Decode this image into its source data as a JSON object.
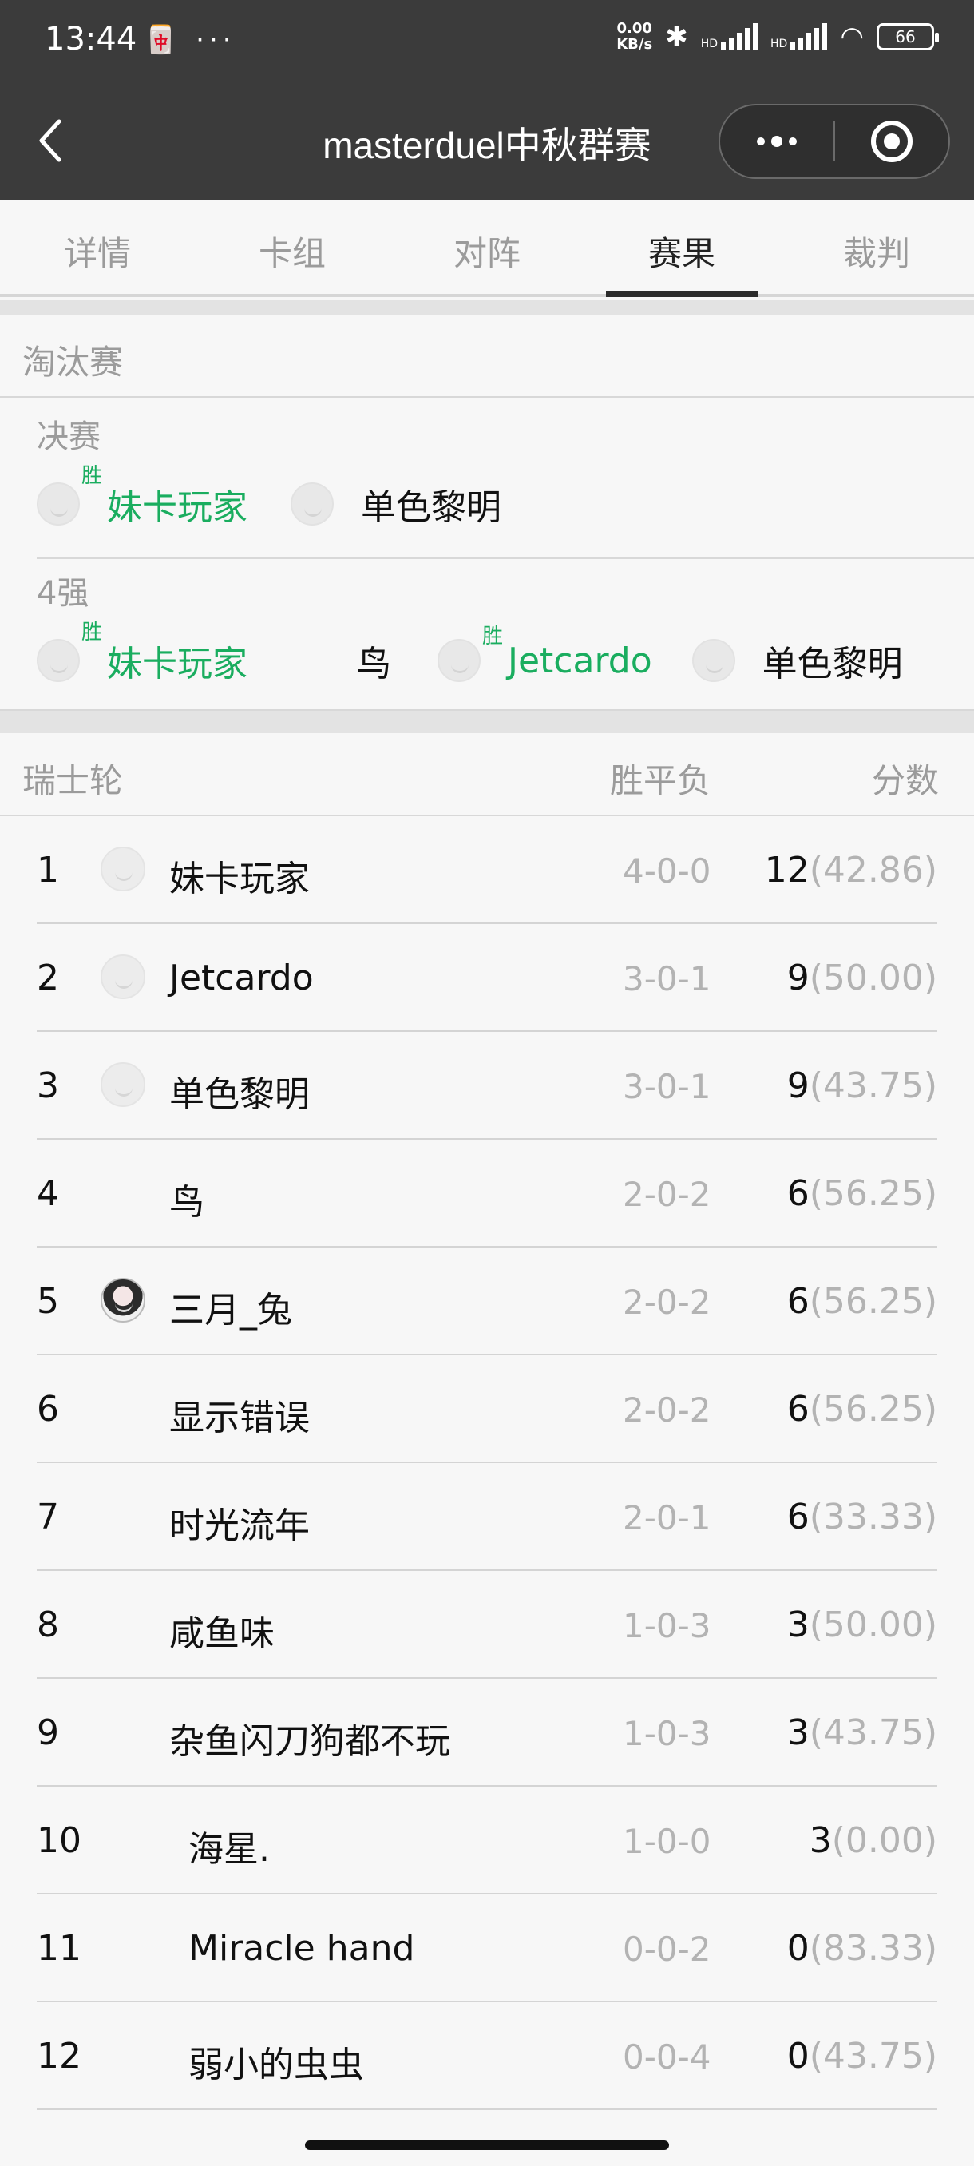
{
  "status_bar": {
    "time": "13:44",
    "left_icons": "🀄 ···",
    "netspeed_value": "0.00",
    "netspeed_unit": "KB/s",
    "signal_label": "HD",
    "battery": "66"
  },
  "header": {
    "title": "masterduel中秋群赛"
  },
  "tabs": [
    {
      "label": "详情",
      "active": false
    },
    {
      "label": "卡组",
      "active": false
    },
    {
      "label": "对阵",
      "active": false
    },
    {
      "label": "赛果",
      "active": true
    },
    {
      "label": "裁判",
      "active": false
    }
  ],
  "knockout": {
    "title": "淘汰赛",
    "win_tag": "胜",
    "rounds": [
      {
        "label": "决赛",
        "matches": [
          {
            "p1": "妹卡玩家",
            "p1_win": true,
            "p2": "单色黎明",
            "p2_win": false
          }
        ]
      },
      {
        "label": "4强",
        "matches": [
          {
            "p1": "妹卡玩家",
            "p1_win": true,
            "p2": "鸟",
            "p2_win": false
          },
          {
            "p1": "Jetcardo",
            "p1_win": true,
            "p2": "单色黎明",
            "p2_win": false
          }
        ]
      }
    ]
  },
  "swiss": {
    "title": "瑞士轮",
    "col_wld": "胜平负",
    "col_score": "分数",
    "rows": [
      {
        "rank": "1",
        "name": "妹卡玩家",
        "wld": "4-0-0",
        "score": "12",
        "pct": "(42.86)"
      },
      {
        "rank": "2",
        "name": "Jetcardo",
        "wld": "3-0-1",
        "score": "9",
        "pct": "(50.00)"
      },
      {
        "rank": "3",
        "name": "单色黎明",
        "wld": "3-0-1",
        "score": "9",
        "pct": "(43.75)"
      },
      {
        "rank": "4",
        "name": "鸟",
        "wld": "2-0-2",
        "score": "6",
        "pct": "(56.25)"
      },
      {
        "rank": "5",
        "name": "三月_兔",
        "wld": "2-0-2",
        "score": "6",
        "pct": "(56.25)"
      },
      {
        "rank": "6",
        "name": "显示错误",
        "wld": "2-0-2",
        "score": "6",
        "pct": "(56.25)"
      },
      {
        "rank": "7",
        "name": "时光流年",
        "wld": "2-0-1",
        "score": "6",
        "pct": "(33.33)"
      },
      {
        "rank": "8",
        "name": "咸鱼味",
        "wld": "1-0-3",
        "score": "3",
        "pct": "(50.00)"
      },
      {
        "rank": "9",
        "name": "杂鱼闪刀狗都不玩",
        "wld": "1-0-3",
        "score": "3",
        "pct": "(43.75)"
      },
      {
        "rank": "10",
        "name": "海星.",
        "wld": "1-0-0",
        "score": "3",
        "pct": "(0.00)"
      },
      {
        "rank": "11",
        "name": "Miracle hand",
        "wld": "0-0-2",
        "score": "0",
        "pct": "(83.33)"
      },
      {
        "rank": "12",
        "name": "弱小的虫虫",
        "wld": "0-0-4",
        "score": "0",
        "pct": "(43.75)"
      }
    ]
  }
}
